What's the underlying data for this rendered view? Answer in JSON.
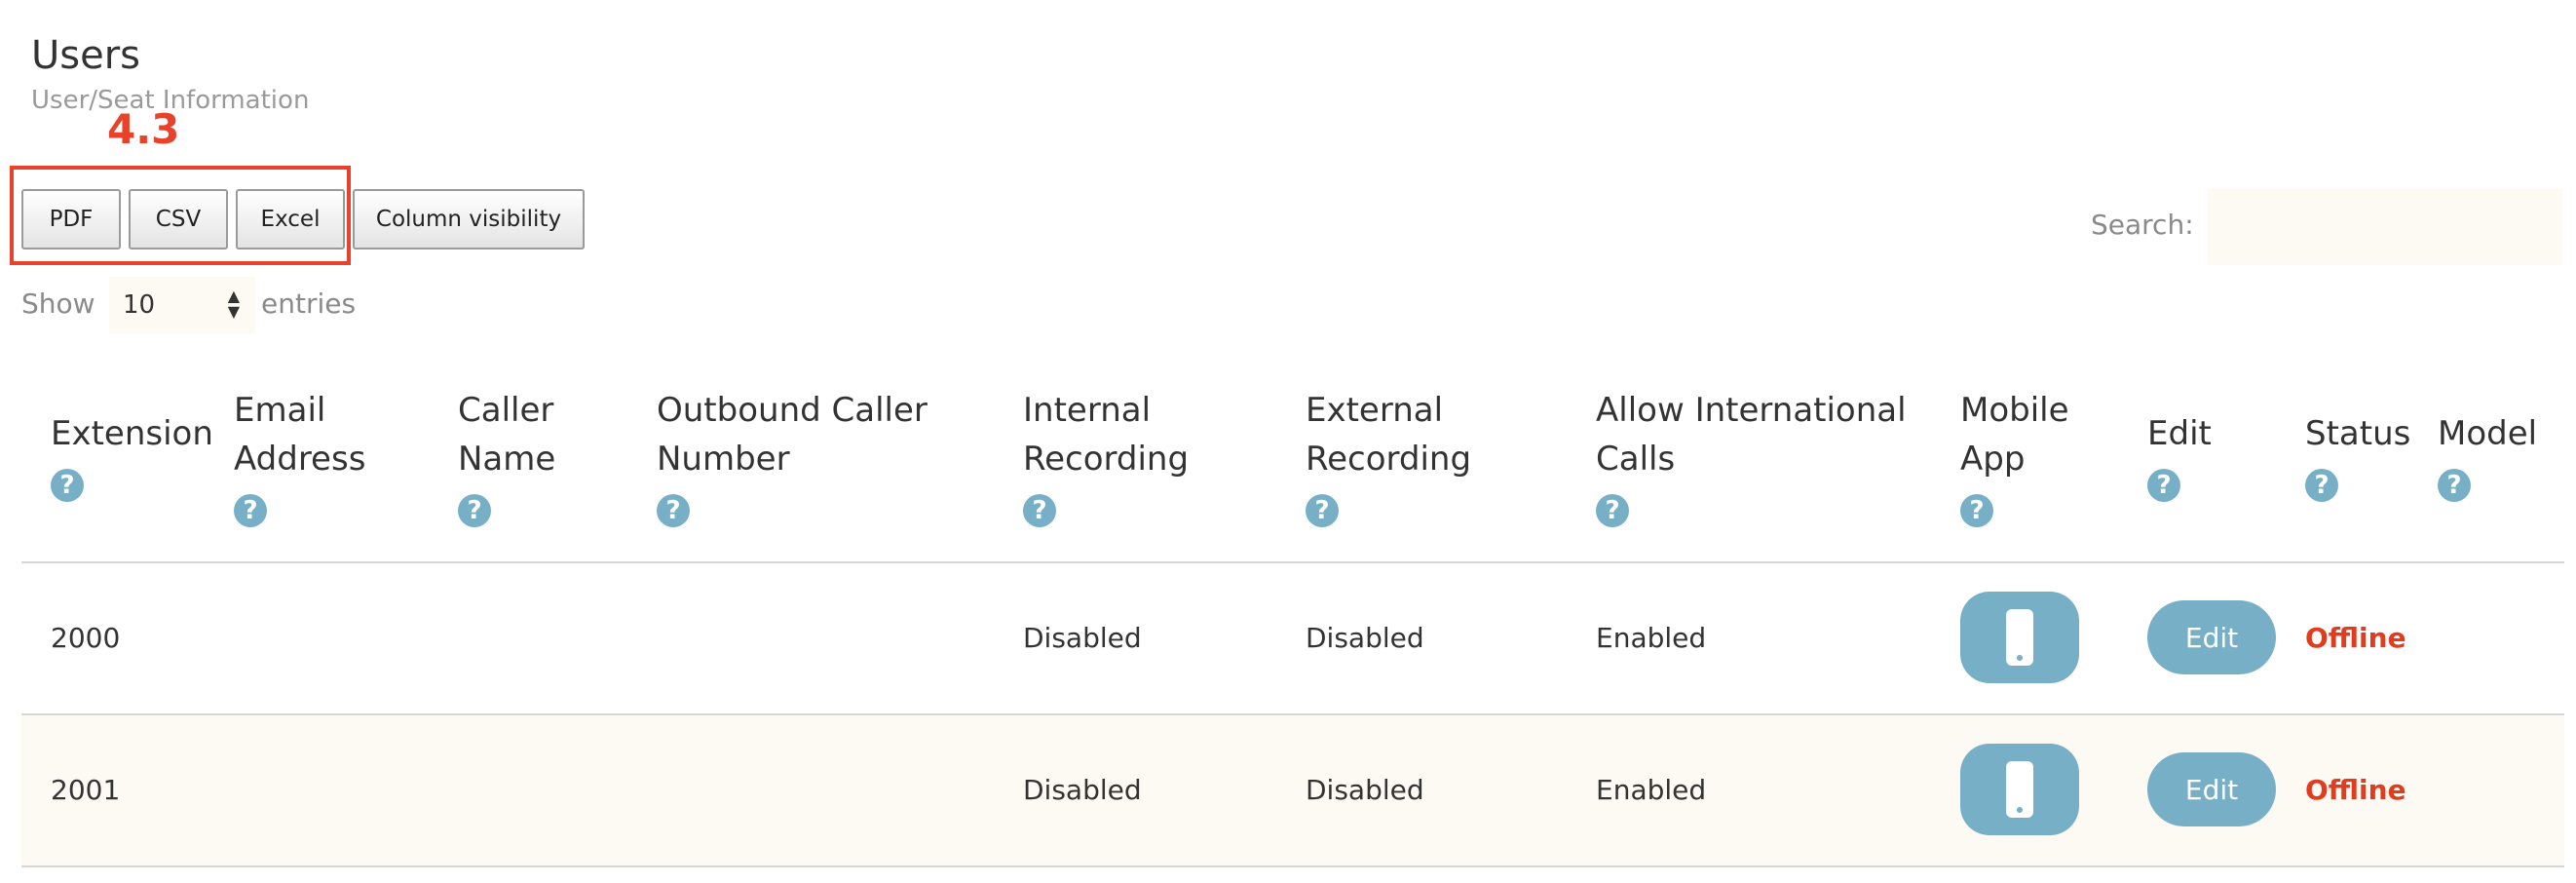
{
  "page": {
    "title": "Users",
    "subtitle": "User/Seat Information",
    "annotation": "4.3"
  },
  "toolbar": {
    "pdf_label": "PDF",
    "csv_label": "CSV",
    "excel_label": "Excel",
    "column_visibility_label": "Column visibility"
  },
  "search": {
    "label": "Search:",
    "value": ""
  },
  "length": {
    "show_label": "Show",
    "selected": "10",
    "entries_label": "entries"
  },
  "table": {
    "columns": [
      {
        "label": "Extension",
        "help_icon": "question-circle-icon"
      },
      {
        "label": "Email\nAddress",
        "help_icon": "question-circle-icon"
      },
      {
        "label": "Caller\nName",
        "help_icon": "question-circle-icon"
      },
      {
        "label": "Outbound Caller\nNumber",
        "help_icon": "question-circle-icon"
      },
      {
        "label": "Internal\nRecording",
        "help_icon": "question-circle-icon"
      },
      {
        "label": "External\nRecording",
        "help_icon": "question-circle-icon"
      },
      {
        "label": "Allow International\nCalls",
        "help_icon": "question-circle-icon"
      },
      {
        "label": "Mobile\nApp",
        "help_icon": "question-circle-icon"
      },
      {
        "label": "Edit",
        "help_icon": "question-circle-icon"
      },
      {
        "label": "Status",
        "help_icon": "question-circle-icon"
      },
      {
        "label": "Model",
        "help_icon": "question-circle-icon"
      }
    ],
    "help_glyph": "?",
    "rows": [
      {
        "extension": "2000",
        "email": "",
        "caller_name": "",
        "outbound_number": "",
        "internal_recording": "Disabled",
        "external_recording": "Disabled",
        "international_calls": "Enabled",
        "mobile_app_icon": "mobile-phone-icon",
        "edit_label": "Edit",
        "status": "Offline",
        "model": ""
      },
      {
        "extension": "2001",
        "email": "",
        "caller_name": "",
        "outbound_number": "",
        "internal_recording": "Disabled",
        "external_recording": "Disabled",
        "international_calls": "Enabled",
        "mobile_app_icon": "mobile-phone-icon",
        "edit_label": "Edit",
        "status": "Offline",
        "model": ""
      }
    ]
  },
  "colors": {
    "accent": "#77afc6",
    "status_offline": "#e23c1e",
    "annotation": "#e8432a",
    "row_alt": "#fdf9f3"
  }
}
